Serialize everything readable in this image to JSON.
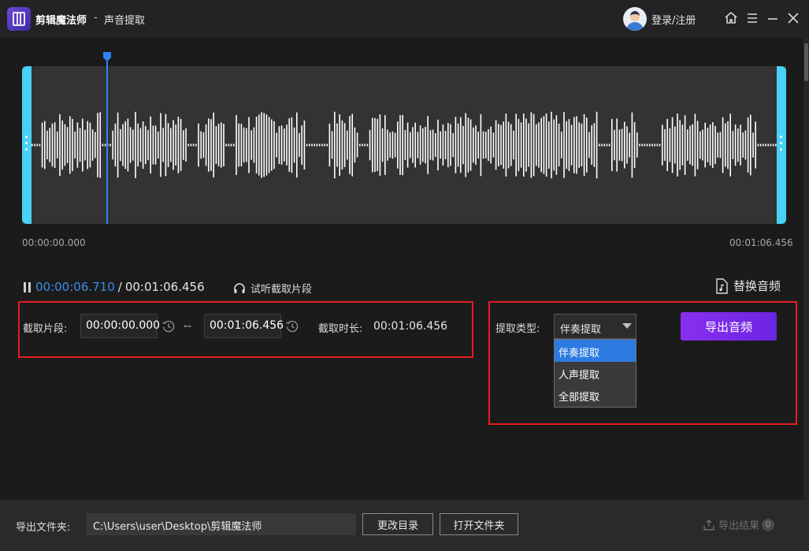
{
  "app": {
    "title": "剪辑魔法师",
    "separator": "-",
    "subtitle": "声音提取"
  },
  "header": {
    "login_label": "登录/注册",
    "icons": [
      "home-icon",
      "menu-icon",
      "minimize-icon",
      "close-icon"
    ]
  },
  "waveform": {
    "start_time": "00:00:00.000",
    "end_time": "00:01:06.456",
    "playhead_fraction": 0.101
  },
  "playback": {
    "current_time": "00:00:06.710",
    "separator": "/",
    "total_time": "00:01:06.456",
    "listen_label": "试听截取片段",
    "replace_label": "替换音频"
  },
  "clip": {
    "label": "截取片段:",
    "start_value": "00:00:00.000",
    "dash": "--",
    "end_value": "00:01:06.456",
    "duration_label": "截取时长:",
    "duration_value": "00:01:06.456"
  },
  "extract": {
    "type_label": "提取类型:",
    "selected": "伴奏提取",
    "options": [
      "伴奏提取",
      "人声提取",
      "全部提取"
    ],
    "export_label": "导出音频"
  },
  "footer": {
    "output_label": "导出文件夹:",
    "output_path": "C:\\Users\\user\\Desktop\\剪辑魔法师",
    "change_dir_label": "更改目录",
    "open_folder_label": "打开文件夹",
    "result_label": "导出结果",
    "result_count": "0"
  },
  "colors": {
    "accent_blue": "#3a8ee8",
    "handle_cyan": "#48d2f7",
    "export_purple": "#8a2ff0",
    "highlight_red": "#e51d1d"
  }
}
